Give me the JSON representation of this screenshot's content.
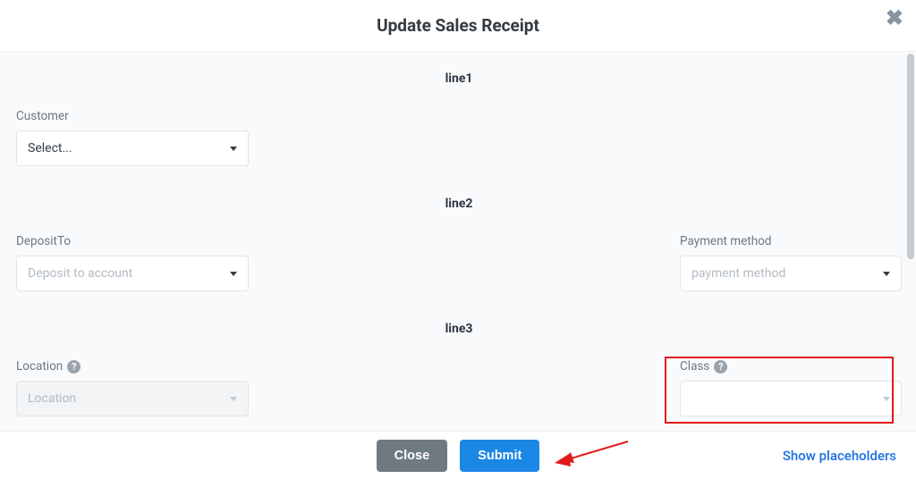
{
  "header": {
    "title": "Update Sales Receipt"
  },
  "sections": {
    "line1": "line1",
    "line2": "line2",
    "line3": "line3"
  },
  "fields": {
    "customer": {
      "label": "Customer",
      "placeholder": "Select..."
    },
    "deposit_to": {
      "label": "DepositTo",
      "placeholder": "Deposit to account"
    },
    "payment_method": {
      "label": "Payment method",
      "placeholder": "payment method"
    },
    "location": {
      "label": "Location",
      "placeholder": "Location"
    },
    "class": {
      "label": "Class",
      "placeholder": ""
    }
  },
  "footer": {
    "close": "Close",
    "submit": "Submit",
    "show_placeholders": "Show placeholders"
  }
}
